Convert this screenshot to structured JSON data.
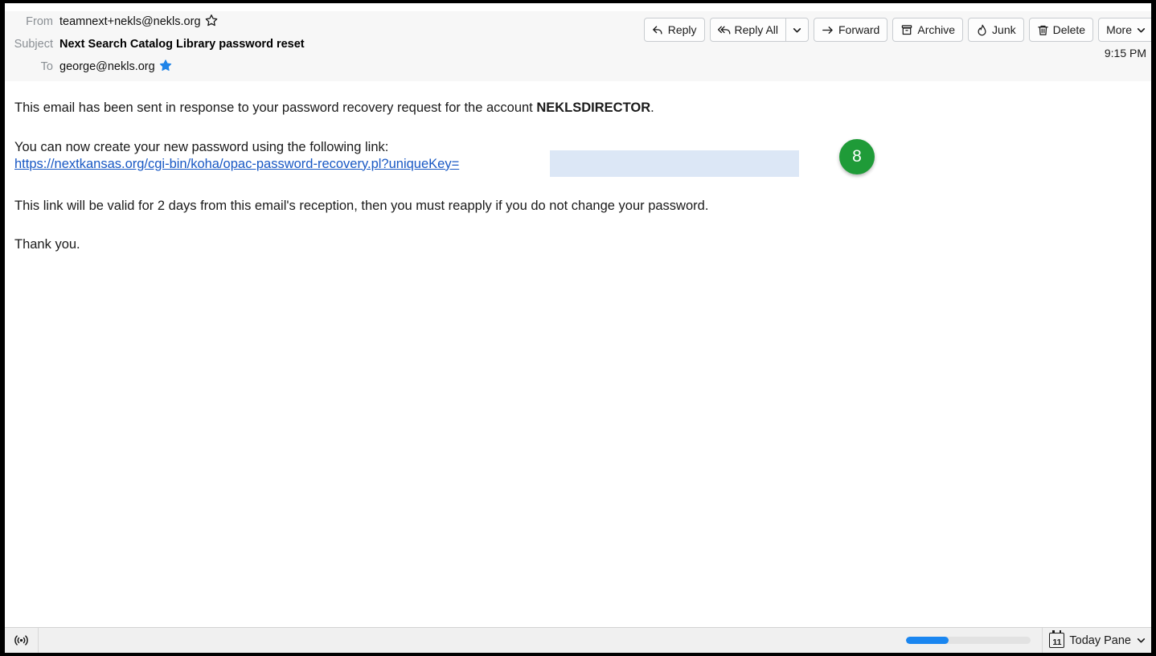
{
  "window": {
    "frame_color": "#000000"
  },
  "header": {
    "from_label": "From",
    "from_value": "teamnext+nekls@nekls.org",
    "subject_label": "Subject",
    "subject_value": "Next Search Catalog Library password reset",
    "to_label": "To",
    "to_value": "george@nekls.org",
    "timestamp": "9:15 PM"
  },
  "toolbar": {
    "reply_label": "Reply",
    "reply_all_label": "Reply All",
    "forward_label": "Forward",
    "archive_label": "Archive",
    "junk_label": "Junk",
    "delete_label": "Delete",
    "more_label": "More"
  },
  "body": {
    "line1_prefix": "This email has been sent in response to your password recovery request for the account ",
    "line1_account": "NEKLSDIRECTOR",
    "line1_suffix": ".",
    "line2": "You can now create your new password using the following link:",
    "link_text": "https://nextkansas.org/cgi-bin/koha/opac-password-recovery.pl?uniqueKey=",
    "line3": "This link will be valid for 2 days from this email's reception, then you must reapply if you do not change your password.",
    "line4": "Thank you.",
    "badge_number": "8",
    "badge_color": "#1f9b38",
    "redaction_color": "#dce7f6",
    "link_color": "#1858c4"
  },
  "statusbar": {
    "today_pane_label": "Today Pane",
    "calendar_day": "11",
    "progress_percent": 34,
    "progress_color": "#1a86f0"
  }
}
